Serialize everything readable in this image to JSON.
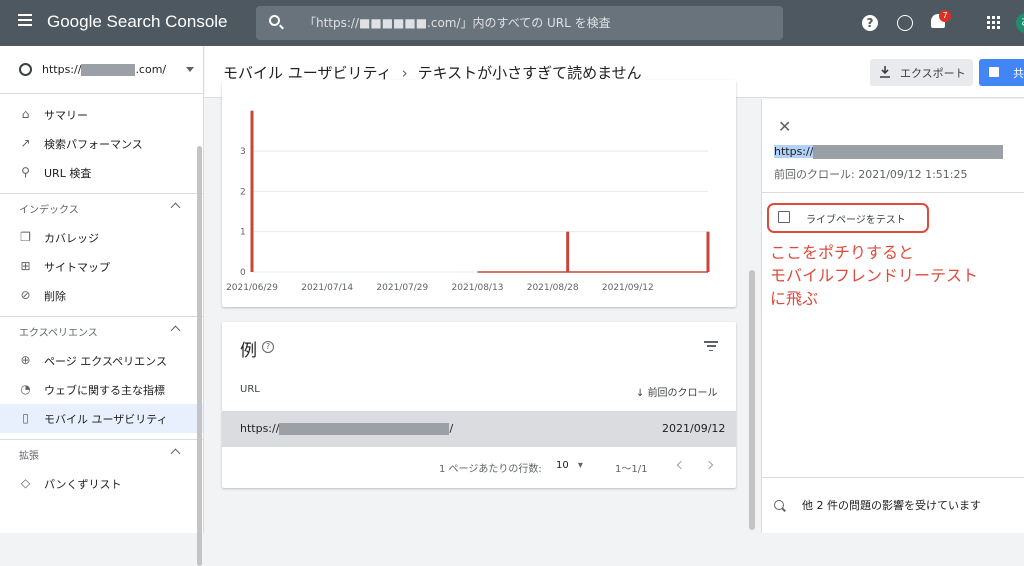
{
  "app": {
    "title": "Google Search Console"
  },
  "search": {
    "placeholder": "「https://■■■■■■.com/」内のすべての URL を検査"
  },
  "topbar": {
    "notification_count": "7",
    "avatar_letter": "お"
  },
  "sidebar": {
    "property_prefix": "https://",
    "property_suffix": ".com/",
    "items_top": [
      {
        "label": "サマリー",
        "icon": "home-icon"
      },
      {
        "label": "検索パフォーマンス",
        "icon": "trending-up-icon"
      },
      {
        "label": "URL 検査",
        "icon": "search-icon"
      }
    ],
    "sections": [
      {
        "title": "インデックス",
        "items": [
          {
            "label": "カバレッジ",
            "icon": "copy-icon"
          },
          {
            "label": "サイトマップ",
            "icon": "sitemap-icon"
          },
          {
            "label": "削除",
            "icon": "visibility-off-icon"
          }
        ]
      },
      {
        "title": "エクスペリエンス",
        "items": [
          {
            "label": "ページ エクスペリエンス",
            "icon": "plus-circle-icon"
          },
          {
            "label": "ウェブに関する主な指標",
            "icon": "speed-icon"
          },
          {
            "label": "モバイル ユーザビリティ",
            "icon": "smartphone-icon"
          }
        ]
      },
      {
        "title": "拡張",
        "items": [
          {
            "label": "パンくずリスト",
            "icon": "layers-icon"
          }
        ]
      }
    ]
  },
  "header": {
    "crumb1": "モバイル ユーザビリティ",
    "separator": "›",
    "crumb2": "テキストが小さすぎて読めません",
    "export_label": "エクスポート",
    "share_label": "共有"
  },
  "chart_data": {
    "type": "bar",
    "x": [
      "2021/06/29",
      "2021/07/14",
      "2021/07/29",
      "2021/08/13",
      "2021/08/28",
      "2021/09/12"
    ],
    "yticks": [
      0,
      1,
      2,
      3
    ],
    "ylim": [
      0,
      3
    ],
    "xlim_days": [
      0,
      91
    ],
    "bars": [
      {
        "date": "2021/06/29",
        "value": 4
      },
      {
        "date": "2021/08/31",
        "value": 1
      },
      {
        "date": "2021/09/28",
        "value": 1
      }
    ],
    "baseline_from": "2021/08/13",
    "color": "#c5473a"
  },
  "examples": {
    "title": "例",
    "col_url": "URL",
    "col_crawl": "前回のクロール",
    "rows": [
      {
        "url_prefix": "https://",
        "url_suffix": "/",
        "date": "2021/09/12"
      }
    ],
    "rows_per_page_label": "1 ページあたりの行数:",
    "rows_per_page": "10",
    "range": "1〜1/1"
  },
  "panel": {
    "url_prefix": "https://",
    "last_crawl": "前回のクロール: 2021/09/12 1:51:25",
    "live_test": "ライブページをテスト",
    "annotation": "ここをポチりすると\nモバイルフレンドリーテスト\nに飛ぶ",
    "issue": "他 2 件の問題の影響を受けています"
  }
}
